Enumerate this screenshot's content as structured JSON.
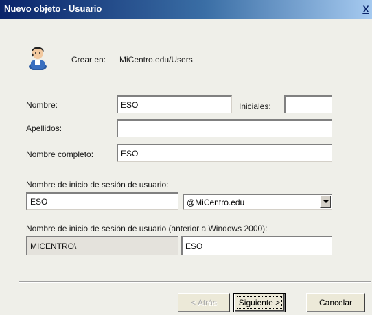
{
  "window": {
    "title": "Nuevo objeto - Usuario",
    "close_glyph": "X"
  },
  "header": {
    "icon": "user-icon",
    "create_in_label": "Crear en:",
    "create_in_value": "MiCentro.edu/Users"
  },
  "form": {
    "first_name_label": "Nombre:",
    "first_name_value": "ESO",
    "initials_label": "Iniciales:",
    "initials_value": "",
    "last_name_label": "Apellidos:",
    "last_name_value": "",
    "full_name_label": "Nombre completo:",
    "full_name_value": "ESO",
    "logon_label": "Nombre de inicio de sesión de usuario:",
    "logon_value": "ESO",
    "domain_value": "@MiCentro.edu",
    "legacy_logon_label": "Nombre de inicio de sesión de usuario (anterior a Windows 2000):",
    "legacy_domain_value": "MICENTRO\\",
    "legacy_logon_value": "ESO"
  },
  "buttons": {
    "back_label": "< Atrás",
    "next_label": "Siguiente >",
    "cancel_label": "Cancelar"
  }
}
